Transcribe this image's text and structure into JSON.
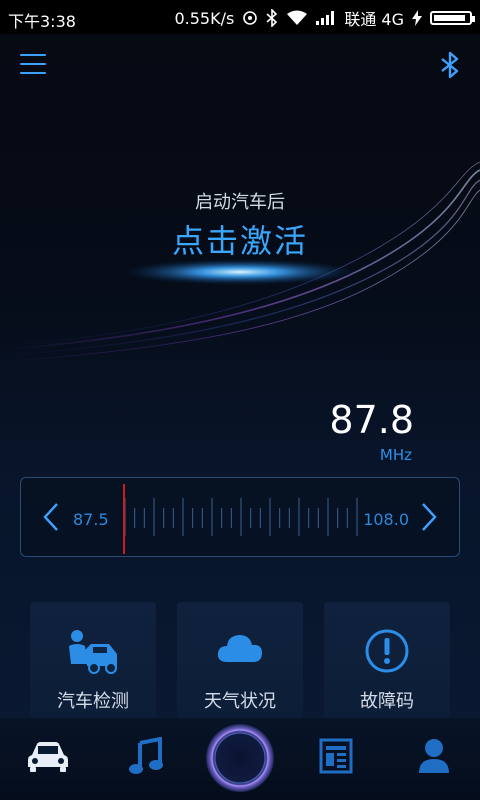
{
  "status_bar": {
    "time": "下午3:38",
    "net_speed": "0.55K/s",
    "carrier": "联通 4G",
    "icons": [
      "sync-icon",
      "bluetooth-icon",
      "wifi-icon",
      "signal-icon",
      "charging-icon",
      "battery-icon"
    ]
  },
  "header": {
    "menu_icon": "hamburger-menu-icon",
    "bluetooth_icon": "bluetooth-icon"
  },
  "activation": {
    "subtitle": "启动汽车后",
    "title": "点击激活"
  },
  "radio": {
    "frequency": "87.8",
    "unit": "MHz",
    "min": "87.5",
    "max": "108.0",
    "current_value": 87.8
  },
  "features": [
    {
      "label": "汽车检测",
      "icon": "car-repair-icon"
    },
    {
      "label": "天气状况",
      "icon": "cloud-icon"
    },
    {
      "label": "故障码",
      "icon": "exclamation-icon"
    }
  ],
  "bottom_nav": [
    {
      "icon": "car-icon",
      "active": true
    },
    {
      "icon": "music-note-icon",
      "active": false
    },
    {
      "icon": "voice-orb-icon",
      "active": false
    },
    {
      "icon": "news-icon",
      "active": false
    },
    {
      "icon": "user-icon",
      "active": false
    }
  ],
  "colors": {
    "accent": "#3aa7ff",
    "needle": "#d11a1a",
    "background": "#060c18"
  }
}
